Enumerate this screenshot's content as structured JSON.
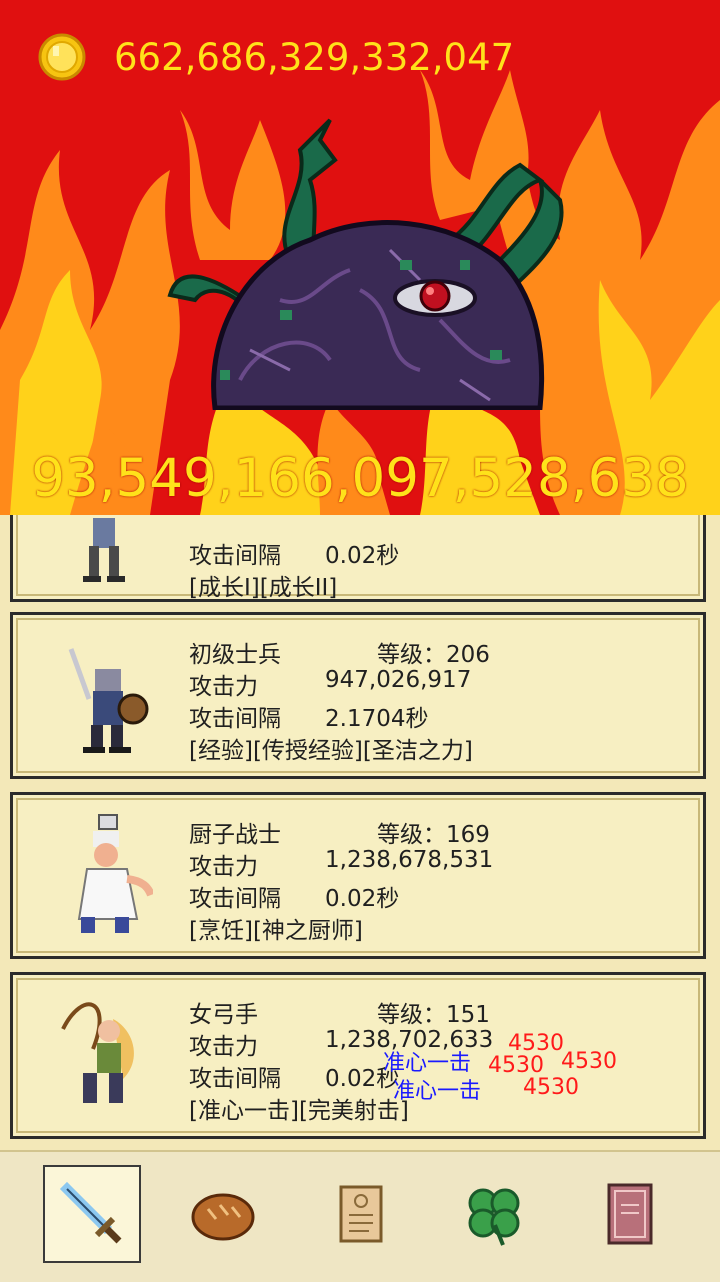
{
  "gold": {
    "icon": "gold-coin-icon",
    "amount": "662,686,329,332,047"
  },
  "boss": {
    "name_icon": "dark-eye-slime-boss",
    "hp": "93,549,166,097,528,638"
  },
  "heroes": [
    {
      "portrait": "bandit-hero-icon",
      "name": "",
      "level": "",
      "attack_label": "",
      "attack": "",
      "interval_label": "攻击间隔",
      "interval": "0.02秒",
      "skills": "[成长I][成长II]"
    },
    {
      "portrait": "soldier-hero-icon",
      "name": "初级士兵",
      "level": "等级：206",
      "attack_label": "攻击力",
      "attack": "947,026,917",
      "interval_label": "攻击间隔",
      "interval": "2.1704秒",
      "skills": "[经验][传授经验][圣洁之力]"
    },
    {
      "portrait": "chef-hero-icon",
      "name": "厨子战士",
      "level": "等级：169",
      "attack_label": "攻击力",
      "attack": "1,238,678,531",
      "interval_label": "攻击间隔",
      "interval": "0.02秒",
      "skills": "[烹饪][神之厨师]"
    },
    {
      "portrait": "archer-hero-icon",
      "name": "女弓手",
      "level": "等级：151",
      "attack_label": "攻击力",
      "attack": "1,238,702,633",
      "interval_label": "攻击间隔",
      "interval": "0.02秒",
      "skills": "[准心一击][完美射击]"
    }
  ],
  "floating_texts": [
    {
      "text": "4530",
      "color": "red"
    },
    {
      "text": "4530",
      "color": "red"
    },
    {
      "text": "4530",
      "color": "red"
    },
    {
      "text": "4530",
      "color": "red"
    },
    {
      "text": "准心一击",
      "color": "blue"
    },
    {
      "text": "准心一击",
      "color": "blue"
    }
  ],
  "nav": [
    {
      "icon": "sword-icon",
      "active": true
    },
    {
      "icon": "bread-icon",
      "active": false
    },
    {
      "icon": "scroll-icon",
      "active": false
    },
    {
      "icon": "clover-icon",
      "active": false
    },
    {
      "icon": "book-icon",
      "active": false
    }
  ],
  "colors": {
    "sky": "#e01010",
    "flame": "#ff8a1a",
    "gold_text": "#ffe21a",
    "panel": "#f7efc2"
  }
}
